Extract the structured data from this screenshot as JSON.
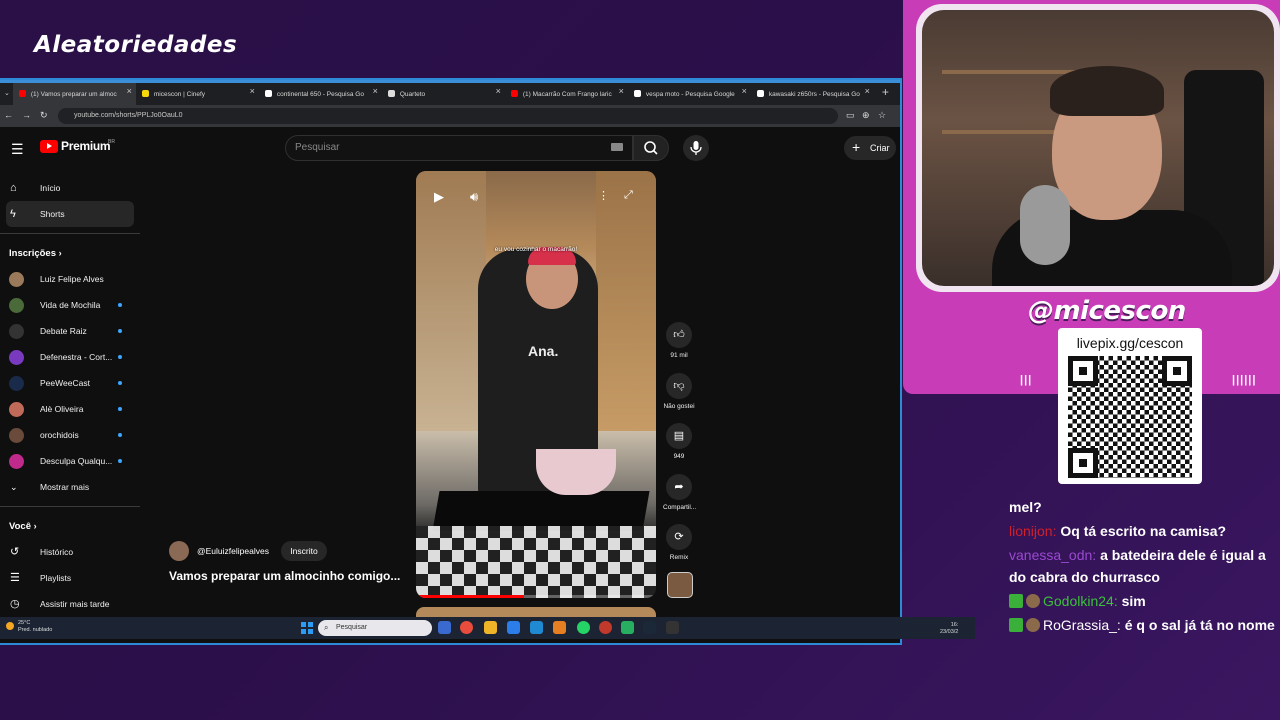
{
  "overlay": {
    "title": "Aleatoriedades"
  },
  "browser": {
    "tabs": [
      {
        "label": "(1) Vamos preparar um almoc",
        "fav_color": "#ff0000",
        "active": true
      },
      {
        "label": "micescon | Cinefy",
        "fav_color": "#f5d90a"
      },
      {
        "label": "continental 650 - Pesquisa Go",
        "fav_color": "#ffffff"
      },
      {
        "label": "Quarteto",
        "fav_color": "#dddddd"
      },
      {
        "label": "(1) Macarrão Com Frango laric",
        "fav_color": "#ff0000"
      },
      {
        "label": "vespa moto - Pesquisa Google",
        "fav_color": "#ffffff"
      },
      {
        "label": "kawasaki z650rs - Pesquisa Go",
        "fav_color": "#ffffff"
      }
    ],
    "new_tab": "+",
    "url": "youtube.com/shorts/PPLJo0OauL0"
  },
  "youtube": {
    "logo_text": "Premium",
    "logo_sup": "BR",
    "search_placeholder": "Pesquisar",
    "create_label": "Criar",
    "sidebar": {
      "main": [
        {
          "label": "Início",
          "icon": "home-icon",
          "glyph": "⌂"
        },
        {
          "label": "Shorts",
          "icon": "shorts-icon",
          "glyph": "ϟ",
          "active": true
        }
      ],
      "subs_title": "Inscrições",
      "channels": [
        {
          "label": "Luiz Felipe Alves",
          "color": "#9a7a5a",
          "dot": false
        },
        {
          "label": "Vida de Mochila",
          "color": "#4a6a3a",
          "dot": true
        },
        {
          "label": "Debate Raiz",
          "color": "#333333",
          "dot": true
        },
        {
          "label": "Defenestra - Cort...",
          "color": "#7a3ac0",
          "dot": true
        },
        {
          "label": "PeeWeeCast",
          "color": "#1a2a4a",
          "dot": true
        },
        {
          "label": "Alè Oliveira",
          "color": "#c06a5a",
          "dot": true
        },
        {
          "label": "orochidois",
          "color": "#6a4a3a",
          "dot": true
        },
        {
          "label": "Desculpa Qualqu...",
          "color": "#c02a8a",
          "dot": true
        }
      ],
      "show_more": "Mostrar mais",
      "you_title": "Você",
      "you_items": [
        {
          "label": "Histórico",
          "icon": "history-icon",
          "glyph": "↺"
        },
        {
          "label": "Playlists",
          "icon": "playlists-icon",
          "glyph": "☰"
        },
        {
          "label": "Assistir mais tarde",
          "icon": "watch-later-icon",
          "glyph": "◷"
        }
      ]
    },
    "short": {
      "caption": "eu vou cozinhar o macarrão!",
      "shirt_text": "Ana.",
      "progress": 0.45,
      "likes": "91 mil",
      "dislike_label": "Não gostei",
      "comments": "949",
      "share_label": "Compartil...",
      "remix_label": "Remix",
      "channel_handle": "@Euluizfelipealves",
      "subscribed_label": "Inscrito",
      "title": "Vamos preparar um almocinho comigo..."
    }
  },
  "taskbar": {
    "weather_temp": "25°C",
    "weather_desc": "Pred. nublado",
    "search_placeholder": "Pesquisar",
    "time": "16:",
    "date": "23/03/2"
  },
  "stream": {
    "handle": "@micescon",
    "qr_url": "livepix.gg/cescon",
    "chat": [
      {
        "user": "",
        "user_color": "#ffffff",
        "message": "mel?"
      },
      {
        "user": "lionijon:",
        "user_color": "#d0202a",
        "message": "Oq tá escrito na camisa?"
      },
      {
        "user": "vanessa_odn:",
        "user_color": "#9a4ad0",
        "message": "a batedeira dele é igual a do cabra do churrasco"
      },
      {
        "user": "Godolkin24:",
        "user_color": "#3ac03a",
        "message": "sim",
        "badges": true
      },
      {
        "user": "RoGrassia_:",
        "user_color": "#ffffff",
        "message": "é q o sal já tá no nome",
        "badges": true
      }
    ]
  }
}
